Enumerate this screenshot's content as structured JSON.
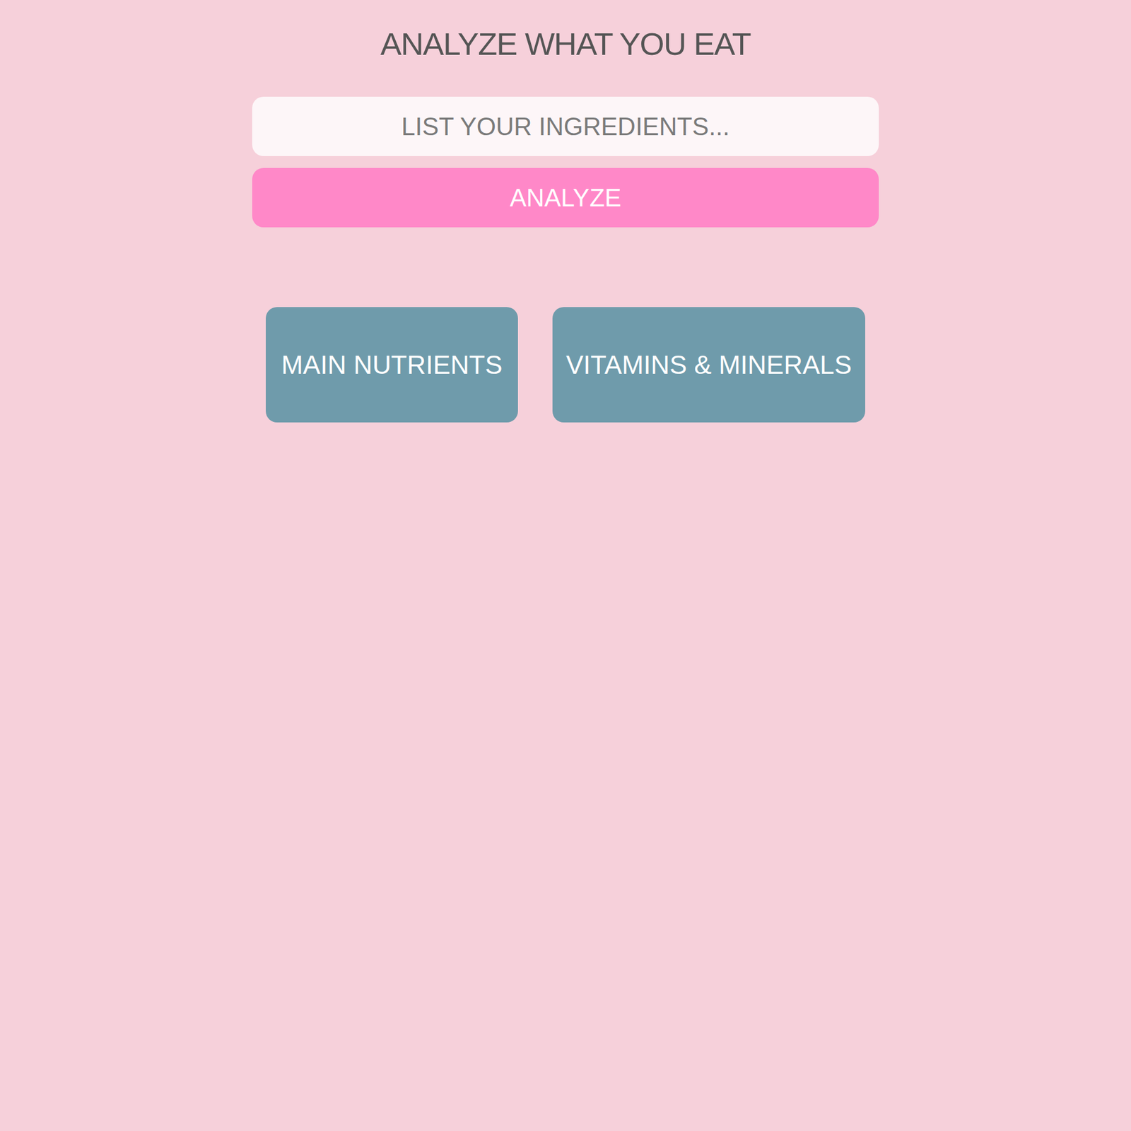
{
  "header": {
    "title": "ANALYZE WHAT YOU EAT"
  },
  "search": {
    "placeholder": "LIST YOUR INGREDIENTS..."
  },
  "analyze_button": {
    "label": "ANALYZE"
  },
  "categories": [
    {
      "label": "MAIN NUTRIENTS"
    },
    {
      "label": "VITAMINS & MINERALS"
    }
  ]
}
